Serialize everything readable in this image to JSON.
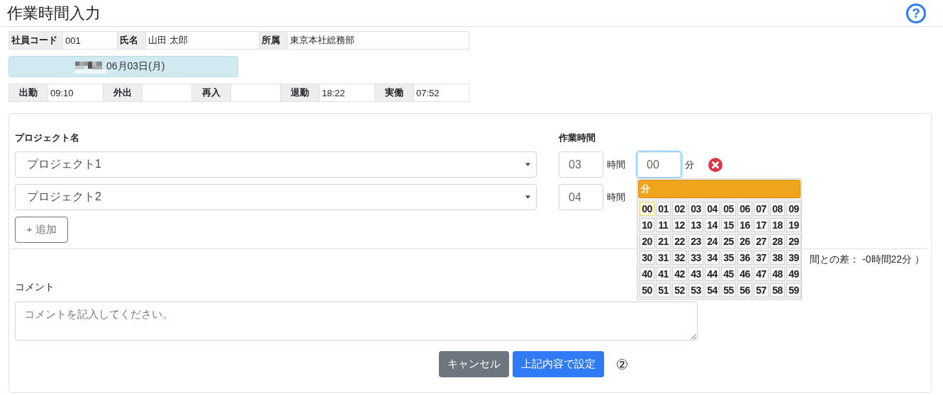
{
  "header": {
    "title": "作業時間入力",
    "help": "?"
  },
  "employee": [
    {
      "label": "社員コード",
      "value": "001"
    },
    {
      "label": "氏名",
      "value": "山田 太郎"
    },
    {
      "label": "所属",
      "value": "東京本社総務部"
    }
  ],
  "date": "06月03日(月)",
  "attendance": [
    {
      "label": "出勤",
      "value": "09:10"
    },
    {
      "label": "外出"
    },
    {
      "label": "再入"
    },
    {
      "label": "退勤",
      "value": "18:22"
    },
    {
      "label": "実働",
      "value": "07:52"
    }
  ],
  "work_form": {
    "project_label": "プロジェクト名",
    "time_label": "作業時間",
    "rows": [
      {
        "project": "プロジェクト1",
        "hours": "03",
        "hours_unit": "時間",
        "minutes": {
          "value": "00",
          "focused": true
        },
        "minutes_unit": "分",
        "removable": true
      },
      {
        "project": "プロジェクト2",
        "hours": "04",
        "hours_unit": "時間"
      }
    ],
    "add_button": "+ 追加",
    "difference_note": "間との差： -0時間22分 ）",
    "comment": {
      "label": "コメント",
      "placeholder": "コメントを記入してください。"
    }
  },
  "buttons": [
    {
      "kind": "secondary",
      "label": "キャンセル"
    },
    {
      "kind": "primary",
      "label": "上記内容で設定"
    }
  ],
  "annotation": "②",
  "minute_picker": {
    "title": "分",
    "options": [
      {
        "label": "00",
        "selected": true
      },
      {
        "label": "01",
        "selected": false
      },
      {
        "label": "02",
        "selected": false
      },
      {
        "label": "03",
        "selected": false
      },
      {
        "label": "04",
        "selected": false
      },
      {
        "label": "05",
        "selected": false
      },
      {
        "label": "06",
        "selected": false
      },
      {
        "label": "07",
        "selected": false
      },
      {
        "label": "08",
        "selected": false
      },
      {
        "label": "09",
        "selected": false
      },
      {
        "label": "10",
        "selected": false
      },
      {
        "label": "11",
        "selected": false
      },
      {
        "label": "12",
        "selected": false
      },
      {
        "label": "13",
        "selected": false
      },
      {
        "label": "14",
        "selected": false
      },
      {
        "label": "15",
        "selected": false
      },
      {
        "label": "16",
        "selected": false
      },
      {
        "label": "17",
        "selected": false
      },
      {
        "label": "18",
        "selected": false
      },
      {
        "label": "19",
        "selected": false
      },
      {
        "label": "20",
        "selected": false
      },
      {
        "label": "21",
        "selected": false
      },
      {
        "label": "22",
        "selected": false
      },
      {
        "label": "23",
        "selected": false
      },
      {
        "label": "24",
        "selected": false
      },
      {
        "label": "25",
        "selected": false
      },
      {
        "label": "26",
        "selected": false
      },
      {
        "label": "27",
        "selected": false
      },
      {
        "label": "28",
        "selected": false
      },
      {
        "label": "29",
        "selected": false
      },
      {
        "label": "30",
        "selected": false
      },
      {
        "label": "31",
        "selected": false
      },
      {
        "label": "32",
        "selected": false
      },
      {
        "label": "33",
        "selected": false
      },
      {
        "label": "34",
        "selected": false
      },
      {
        "label": "35",
        "selected": false
      },
      {
        "label": "36",
        "selected": false
      },
      {
        "label": "37",
        "selected": false
      },
      {
        "label": "38",
        "selected": false
      },
      {
        "label": "39",
        "selected": false
      },
      {
        "label": "40",
        "selected": false
      },
      {
        "label": "41",
        "selected": false
      },
      {
        "label": "42",
        "selected": false
      },
      {
        "label": "43",
        "selected": false
      },
      {
        "label": "44",
        "selected": false
      },
      {
        "label": "45",
        "selected": false
      },
      {
        "label": "46",
        "selected": false
      },
      {
        "label": "47",
        "selected": false
      },
      {
        "label": "48",
        "selected": false
      },
      {
        "label": "49",
        "selected": false
      },
      {
        "label": "50",
        "selected": false
      },
      {
        "label": "51",
        "selected": false
      },
      {
        "label": "52",
        "selected": false
      },
      {
        "label": "53",
        "selected": false
      },
      {
        "label": "54",
        "selected": false
      },
      {
        "label": "55",
        "selected": false
      },
      {
        "label": "56",
        "selected": false
      },
      {
        "label": "57",
        "selected": false
      },
      {
        "label": "58",
        "selected": false
      },
      {
        "label": "59",
        "selected": false
      }
    ]
  }
}
